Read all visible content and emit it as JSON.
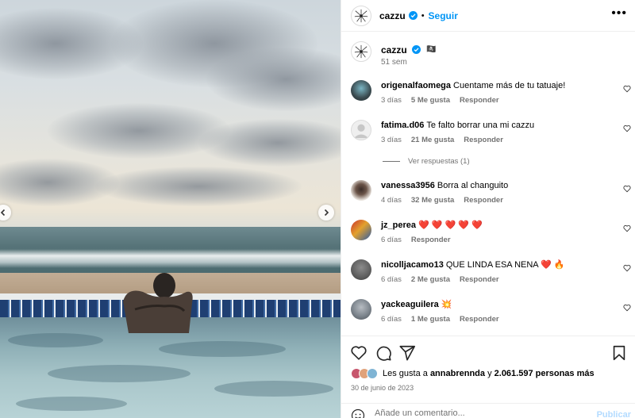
{
  "post": {
    "username": "cazzu",
    "follow_label": "Seguir",
    "dot": "•",
    "more": "•••",
    "caption_flag": "🏴‍☠️",
    "caption_time": "51 sem"
  },
  "comments": [
    {
      "user": "origenalfaomega",
      "text": "Cuentame más de tu tatuaje!",
      "time": "3 días",
      "likes": "5 Me gusta",
      "reply": "Responder",
      "avatar_color": "#3a4a4f"
    },
    {
      "user": "fatima.d06",
      "text": "Te falto borrar una mi cazzu",
      "time": "3 días",
      "likes": "21 Me gusta",
      "reply": "Responder",
      "avatar_color": "#dbdbdb"
    },
    {
      "user": "vanessa3956",
      "text": "Borra al changuito",
      "time": "4 días",
      "likes": "32 Me gusta",
      "reply": "Responder",
      "avatar_color": "#c9b5a8"
    },
    {
      "user": "jz_perea",
      "text": "❤️ ❤️ ❤️ ❤️ ❤️",
      "time": "6 días",
      "likes": "",
      "reply": "Responder",
      "avatar_color": "#d9a530"
    },
    {
      "user": "nicolljacamo13",
      "text": "QUE LINDA ESA NENA ❤️ 🔥",
      "time": "6 días",
      "likes": "2 Me gusta",
      "reply": "Responder",
      "avatar_color": "#6a6a6a"
    },
    {
      "user": "yackeaguilera",
      "text": "💥",
      "time": "6 días",
      "likes": "1 Me gusta",
      "reply": "Responder",
      "avatar_color": "#8a9199"
    }
  ],
  "replies_label": "Ver respuestas (1)",
  "likes": {
    "prefix": "Les gusta a",
    "user": "annabrennda",
    "connector": "y",
    "count": "2.061.597 personas más"
  },
  "date": "30 de junio de 2023",
  "composer": {
    "placeholder": "Añade un comentario...",
    "post_label": "Publicar"
  },
  "icons": {
    "like": "heart-icon",
    "comment": "comment-icon",
    "share": "send-icon",
    "save": "bookmark-icon",
    "emoji": "smiley-icon"
  },
  "colors": {
    "accent": "#0095f6",
    "heart": "#ed4956",
    "muted": "#737373"
  }
}
